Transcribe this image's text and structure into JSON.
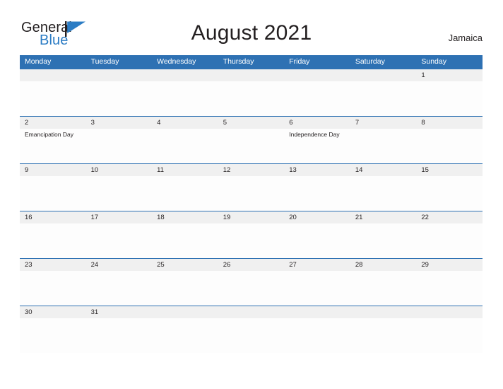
{
  "header": {
    "brand_general": "General",
    "brand_blue": "Blue",
    "brand_flag_icon": "flag-triangle-icon",
    "title": "August 2021",
    "region": "Jamaica",
    "accent_color": "#2e71b3",
    "brand_blue_color": "#2b7cc4",
    "band_color": "#f0f0f0"
  },
  "calendar": {
    "weekdays": [
      "Monday",
      "Tuesday",
      "Wednesday",
      "Thursday",
      "Friday",
      "Saturday",
      "Sunday"
    ],
    "weeks": [
      {
        "days": [
          {
            "num": "",
            "event": ""
          },
          {
            "num": "",
            "event": ""
          },
          {
            "num": "",
            "event": ""
          },
          {
            "num": "",
            "event": ""
          },
          {
            "num": "",
            "event": ""
          },
          {
            "num": "",
            "event": ""
          },
          {
            "num": "1",
            "event": ""
          }
        ]
      },
      {
        "days": [
          {
            "num": "2",
            "event": "Emancipation Day"
          },
          {
            "num": "3",
            "event": ""
          },
          {
            "num": "4",
            "event": ""
          },
          {
            "num": "5",
            "event": ""
          },
          {
            "num": "6",
            "event": "Independence Day"
          },
          {
            "num": "7",
            "event": ""
          },
          {
            "num": "8",
            "event": ""
          }
        ]
      },
      {
        "days": [
          {
            "num": "9",
            "event": ""
          },
          {
            "num": "10",
            "event": ""
          },
          {
            "num": "11",
            "event": ""
          },
          {
            "num": "12",
            "event": ""
          },
          {
            "num": "13",
            "event": ""
          },
          {
            "num": "14",
            "event": ""
          },
          {
            "num": "15",
            "event": ""
          }
        ]
      },
      {
        "days": [
          {
            "num": "16",
            "event": ""
          },
          {
            "num": "17",
            "event": ""
          },
          {
            "num": "18",
            "event": ""
          },
          {
            "num": "19",
            "event": ""
          },
          {
            "num": "20",
            "event": ""
          },
          {
            "num": "21",
            "event": ""
          },
          {
            "num": "22",
            "event": ""
          }
        ]
      },
      {
        "days": [
          {
            "num": "23",
            "event": ""
          },
          {
            "num": "24",
            "event": ""
          },
          {
            "num": "25",
            "event": ""
          },
          {
            "num": "26",
            "event": ""
          },
          {
            "num": "27",
            "event": ""
          },
          {
            "num": "28",
            "event": ""
          },
          {
            "num": "29",
            "event": ""
          }
        ]
      },
      {
        "days": [
          {
            "num": "30",
            "event": ""
          },
          {
            "num": "31",
            "event": ""
          },
          {
            "num": "",
            "event": ""
          },
          {
            "num": "",
            "event": ""
          },
          {
            "num": "",
            "event": ""
          },
          {
            "num": "",
            "event": ""
          },
          {
            "num": "",
            "event": ""
          }
        ]
      }
    ]
  }
}
